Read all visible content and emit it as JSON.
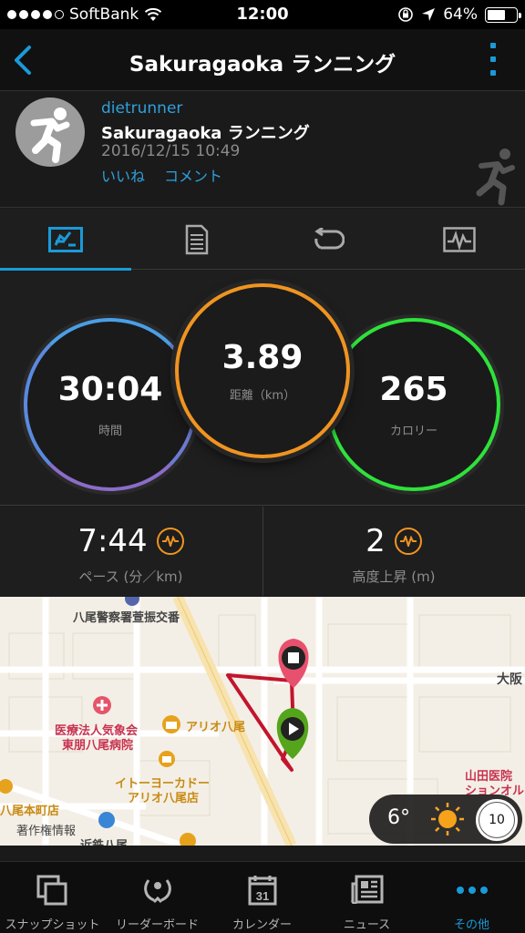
{
  "status_bar": {
    "carrier": "SoftBank",
    "time": "12:00",
    "battery": "64%",
    "battery_level": 0.64
  },
  "nav": {
    "title": "Sakuragaoka ランニング"
  },
  "activity": {
    "user": "dietrunner",
    "name": "Sakuragaoka ランニング",
    "date": "2016/12/15 10:49",
    "like": "いいね",
    "comment": "コメント"
  },
  "tabs": [
    {
      "icon": "overview-icon",
      "active": true
    },
    {
      "icon": "document-icon",
      "active": false
    },
    {
      "icon": "laps-icon",
      "active": false
    },
    {
      "icon": "chart-icon",
      "active": false
    }
  ],
  "circles": {
    "time": {
      "value": "30:04",
      "label": "時間"
    },
    "distance": {
      "value": "3.89",
      "label": "距離（km）"
    },
    "calories": {
      "value": "265",
      "label": "カロリー"
    }
  },
  "stats": {
    "pace": {
      "value": "7:44",
      "label": "ペース (分／km)"
    },
    "elevation": {
      "value": "2",
      "label": "高度上昇 (m)"
    }
  },
  "map": {
    "labels": {
      "police": "八尾警察署萱振交番",
      "hospital1": "医療法人気象会",
      "hospital2": "東朋八尾病院",
      "ario": "アリオ八尾",
      "itoyokado1": "イトーヨーカドー",
      "itoyokado2": "アリオ八尾店",
      "yao_store": "八尾本町店",
      "copyright": "著作権情報",
      "kintetsu": "近鉄八尾",
      "osaka": "大阪",
      "yamada1": "山田医院",
      "yamada2": "ションオル"
    },
    "weather": {
      "temp": "6°",
      "clock": "10"
    }
  },
  "bottom_nav": [
    {
      "label": "スナップショット",
      "icon": "snapshot-icon",
      "active": false
    },
    {
      "label": "リーダーボード",
      "icon": "leaderboard-icon",
      "active": false
    },
    {
      "label": "カレンダー",
      "icon": "calendar-icon",
      "active": false,
      "day": "31"
    },
    {
      "label": "ニュース",
      "icon": "news-icon",
      "active": false
    },
    {
      "label": "その他",
      "icon": "more-icon",
      "active": true
    }
  ],
  "colors": {
    "accent_blue": "#1a9ad8",
    "orange": "#f09420",
    "green": "#2ee23a",
    "purple_blue": "#6c7ad0"
  }
}
